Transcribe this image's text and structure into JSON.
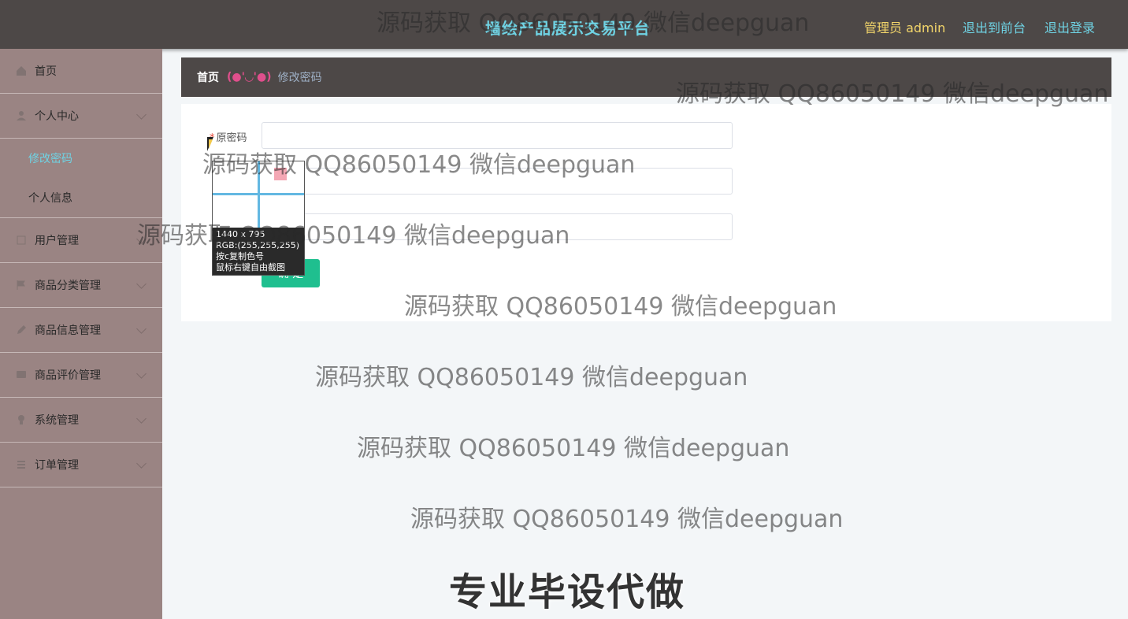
{
  "header": {
    "title": "墙绘产品展示交易平台",
    "admin_label": "管理员 admin",
    "front_link": "退出到前台",
    "logout_link": "退出登录"
  },
  "sidebar": {
    "items": [
      {
        "label": "首页",
        "icon": "home-icon"
      },
      {
        "label": "个人中心",
        "icon": "user-icon",
        "children": [
          {
            "label": "修改密码",
            "active": true
          },
          {
            "label": "个人信息",
            "active": false
          }
        ]
      },
      {
        "label": "用户管理",
        "icon": "users-icon"
      },
      {
        "label": "商品分类管理",
        "icon": "flag-icon"
      },
      {
        "label": "商品信息管理",
        "icon": "edit-icon"
      },
      {
        "label": "商品评价管理",
        "icon": "comment-icon"
      },
      {
        "label": "系统管理",
        "icon": "settings-icon"
      },
      {
        "label": "订单管理",
        "icon": "list-icon"
      }
    ]
  },
  "breadcrumb": {
    "home": "首页",
    "separator": "(●'◡'●)",
    "current": "修改密码"
  },
  "form": {
    "old_password_label": "原密码",
    "required_mark": "*",
    "submit_label": "确 定"
  },
  "picker": {
    "size": "1440 x 795",
    "rgb": "RGB:(255,255,255)",
    "hint1": "按c复制色号",
    "hint2": "鼠标右键自由截图"
  },
  "watermarks": {
    "text": "源码获取 QQ86050149 微信deepguan",
    "big": "专业毕设代做"
  },
  "colors": {
    "header_bg": "#4d4847",
    "sidebar_bg": "#9a8483",
    "accent": "#6fd3e4",
    "button": "#1fbf8f"
  }
}
